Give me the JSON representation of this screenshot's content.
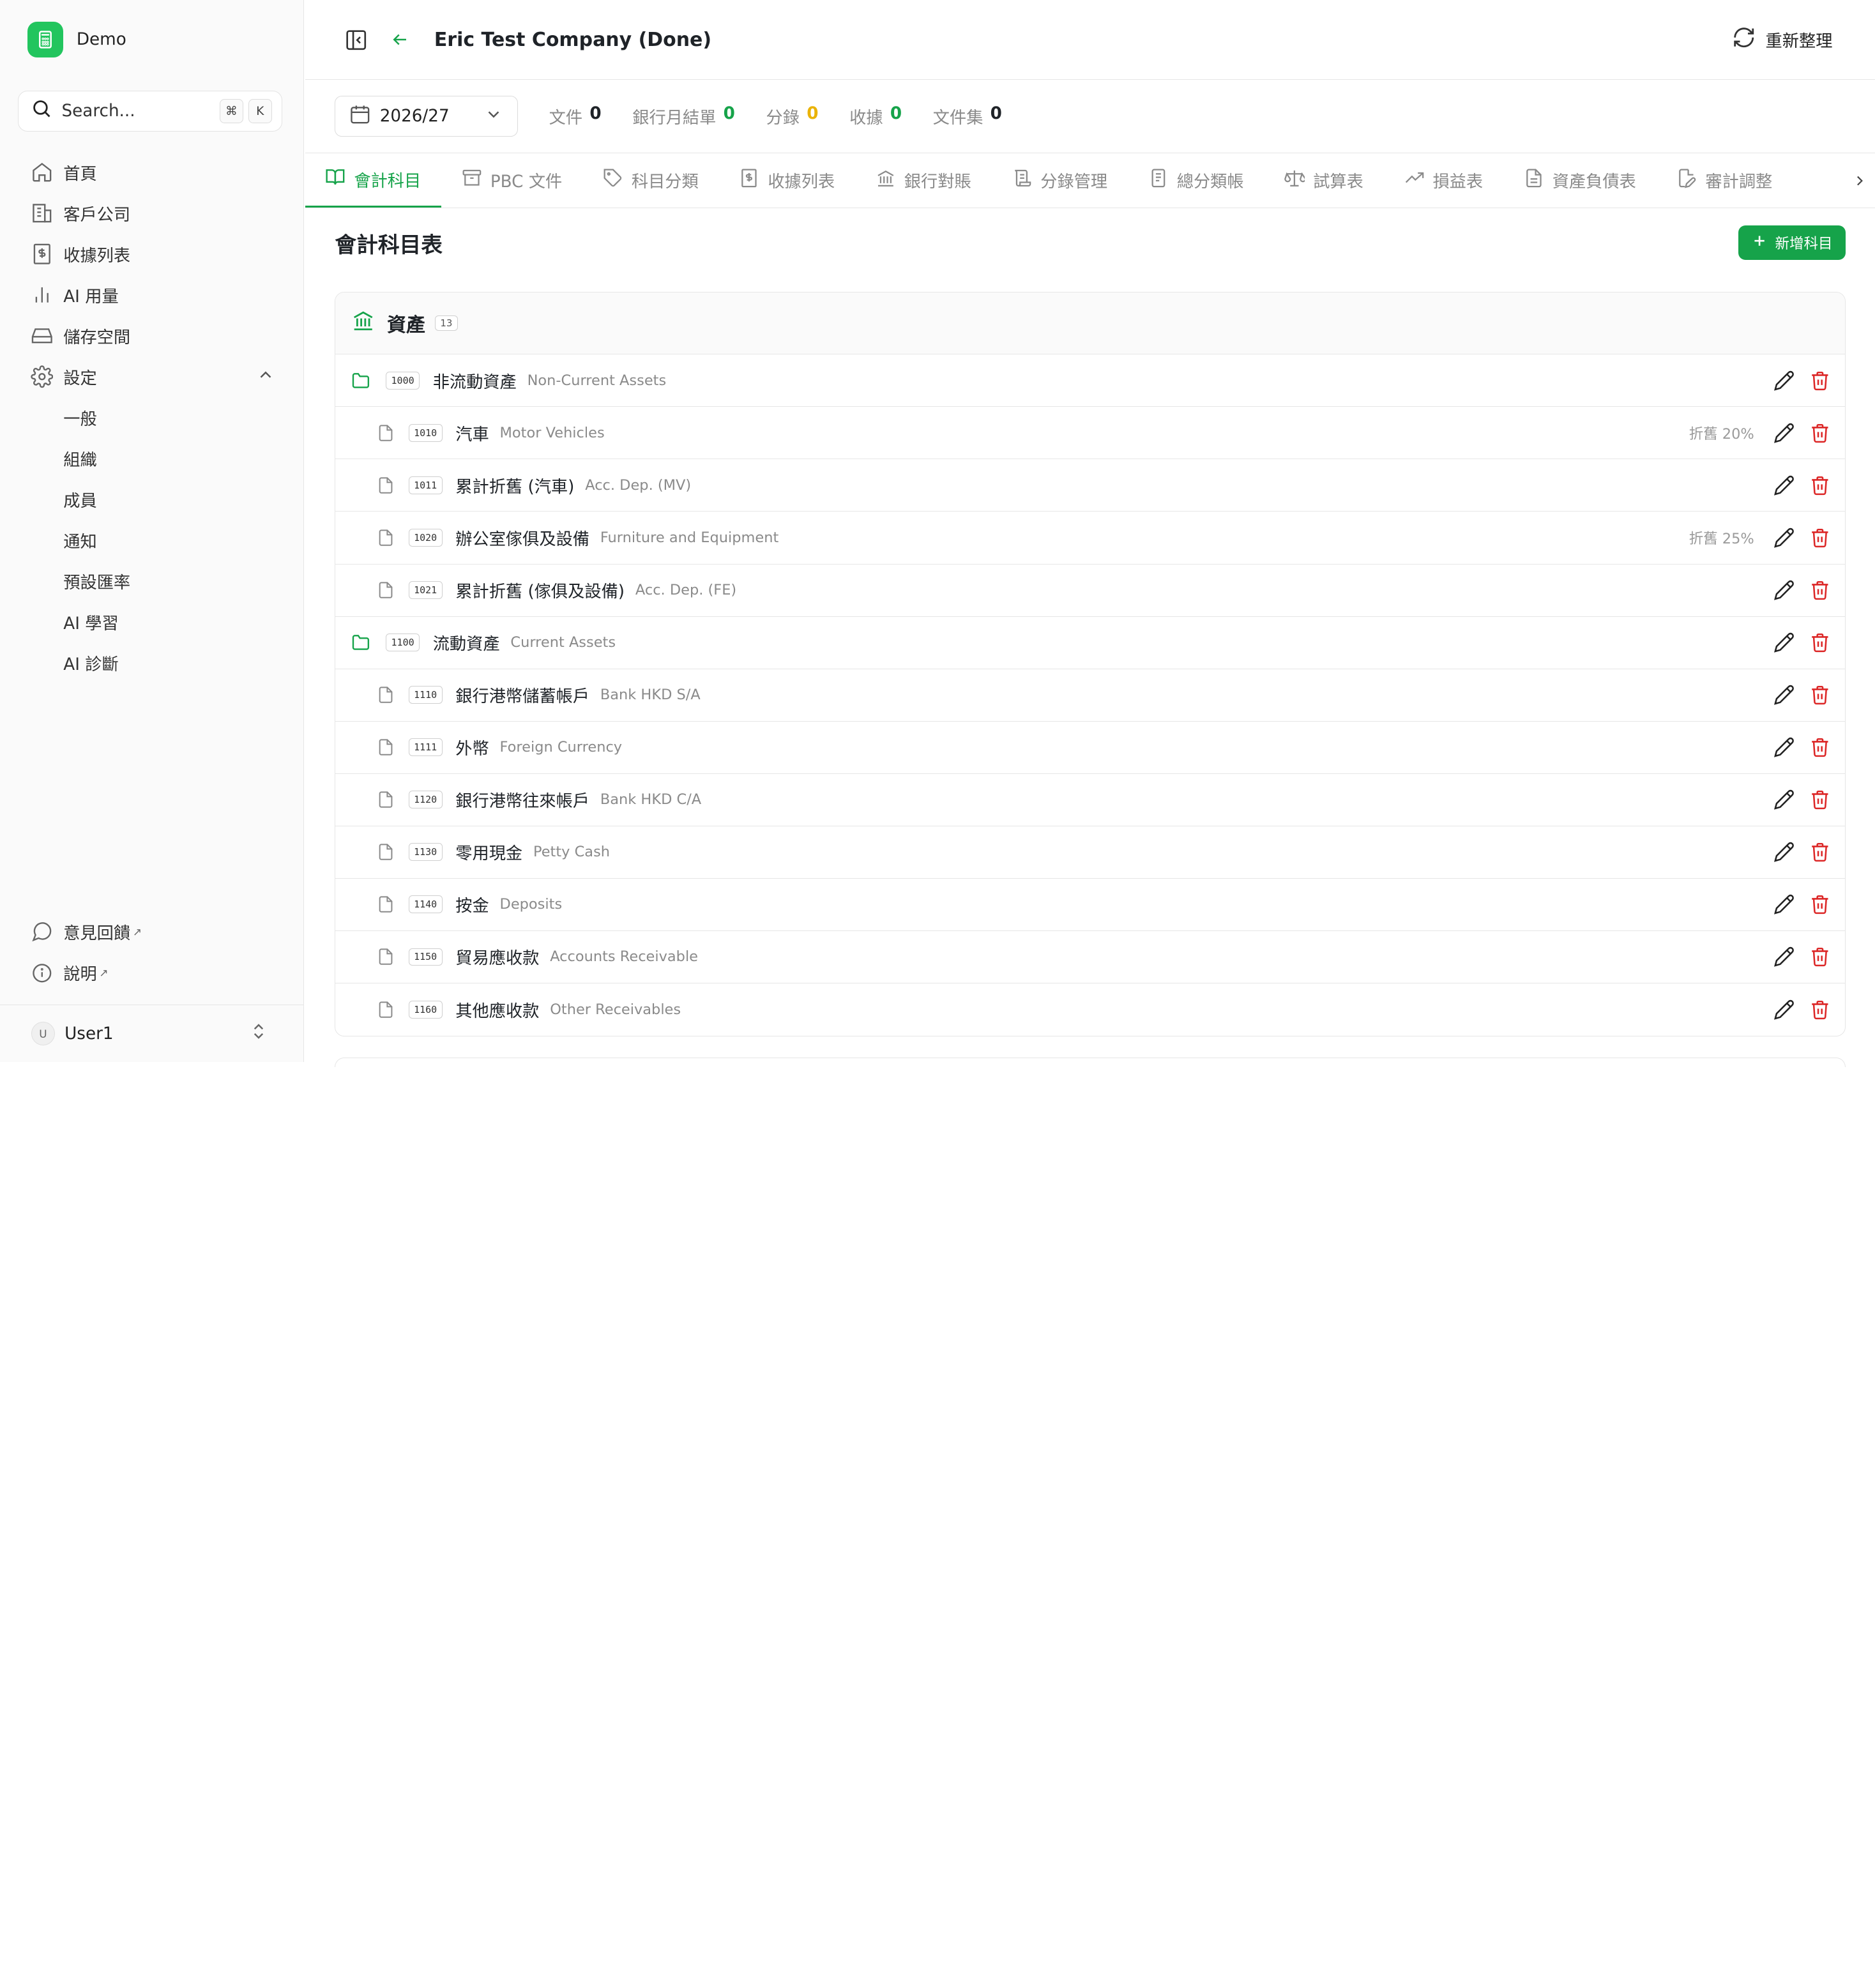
{
  "app": {
    "name": "Demo"
  },
  "search": {
    "placeholder": "Search...",
    "shortcut_mod": "⌘",
    "shortcut_key": "K"
  },
  "sidebar": {
    "items": [
      {
        "label": "首頁",
        "icon": "home-icon"
      },
      {
        "label": "客戶公司",
        "icon": "building-icon"
      },
      {
        "label": "收據列表",
        "icon": "receipt-icon"
      },
      {
        "label": "AI 用量",
        "icon": "bar-chart-icon"
      },
      {
        "label": "儲存空間",
        "icon": "hard-drive-icon"
      },
      {
        "label": "設定",
        "icon": "gear-icon",
        "expanded": true
      }
    ],
    "settings_sub": [
      "一般",
      "組織",
      "成員",
      "通知",
      "預設匯率",
      "AI 學習",
      "AI 診斷"
    ],
    "bottom": [
      {
        "label": "意見回饋",
        "icon": "message-icon",
        "external": "↗"
      },
      {
        "label": "說明",
        "icon": "info-icon",
        "external": "↗"
      }
    ],
    "user": {
      "initial": "U",
      "name": "User1"
    }
  },
  "header": {
    "title": "Eric Test Company (Done)",
    "refresh_label": "重新整理"
  },
  "stats": {
    "year": "2026/27",
    "items": [
      {
        "label": "文件",
        "value": "0",
        "color": "#1f2328"
      },
      {
        "label": "銀行月結單",
        "value": "0",
        "color": "#16a34a"
      },
      {
        "label": "分錄",
        "value": "0",
        "color": "#eab308"
      },
      {
        "label": "收據",
        "value": "0",
        "color": "#16a34a"
      },
      {
        "label": "文件集",
        "value": "0",
        "color": "#1f2328"
      }
    ]
  },
  "tabs": [
    {
      "label": "會計科目",
      "icon": "book-open-icon",
      "active": true
    },
    {
      "label": "PBC 文件",
      "icon": "archive-icon"
    },
    {
      "label": "科目分類",
      "icon": "tag-icon"
    },
    {
      "label": "收據列表",
      "icon": "receipt-icon"
    },
    {
      "label": "銀行對賬",
      "icon": "bank-icon"
    },
    {
      "label": "分錄管理",
      "icon": "scroll-icon"
    },
    {
      "label": "總分類帳",
      "icon": "ledger-icon"
    },
    {
      "label": "試算表",
      "icon": "scale-icon"
    },
    {
      "label": "損益表",
      "icon": "trending-up-icon"
    },
    {
      "label": "資產負債表",
      "icon": "sheet-icon"
    },
    {
      "label": "審計調整",
      "icon": "file-edit-icon"
    }
  ],
  "content": {
    "title": "會計科目表",
    "add_label": "新增科目",
    "section": {
      "title": "資產",
      "count": "13"
    },
    "rows": [
      {
        "type": "group",
        "code": "1000",
        "zh": "非流動資產",
        "en": "Non-Current Assets",
        "dep": ""
      },
      {
        "type": "leaf",
        "code": "1010",
        "zh": "汽車",
        "en": "Motor Vehicles",
        "dep": "折舊 20%"
      },
      {
        "type": "leaf",
        "code": "1011",
        "zh": "累計折舊 (汽車)",
        "en": "Acc. Dep. (MV)",
        "dep": ""
      },
      {
        "type": "leaf",
        "code": "1020",
        "zh": "辦公室傢俱及設備",
        "en": "Furniture and Equipment",
        "dep": "折舊 25%"
      },
      {
        "type": "leaf",
        "code": "1021",
        "zh": "累計折舊 (傢俱及設備)",
        "en": "Acc. Dep. (FE)",
        "dep": ""
      },
      {
        "type": "group",
        "code": "1100",
        "zh": "流動資產",
        "en": "Current Assets",
        "dep": ""
      },
      {
        "type": "leaf",
        "code": "1110",
        "zh": "銀行港幣儲蓄帳戶",
        "en": "Bank HKD S/A",
        "dep": ""
      },
      {
        "type": "leaf",
        "code": "1111",
        "zh": "外幣",
        "en": "Foreign Currency",
        "dep": ""
      },
      {
        "type": "leaf",
        "code": "1120",
        "zh": "銀行港幣往來帳戶",
        "en": "Bank HKD C/A",
        "dep": ""
      },
      {
        "type": "leaf",
        "code": "1130",
        "zh": "零用現金",
        "en": "Petty Cash",
        "dep": ""
      },
      {
        "type": "leaf",
        "code": "1140",
        "zh": "按金",
        "en": "Deposits",
        "dep": ""
      },
      {
        "type": "leaf",
        "code": "1150",
        "zh": "貿易應收款",
        "en": "Accounts Receivable",
        "dep": ""
      },
      {
        "type": "leaf",
        "code": "1160",
        "zh": "其他應收款",
        "en": "Other Receivables",
        "dep": ""
      }
    ]
  },
  "colors": {
    "accent": "#16a34a",
    "danger": "#dc2626",
    "muted": "#8a8a8a"
  }
}
